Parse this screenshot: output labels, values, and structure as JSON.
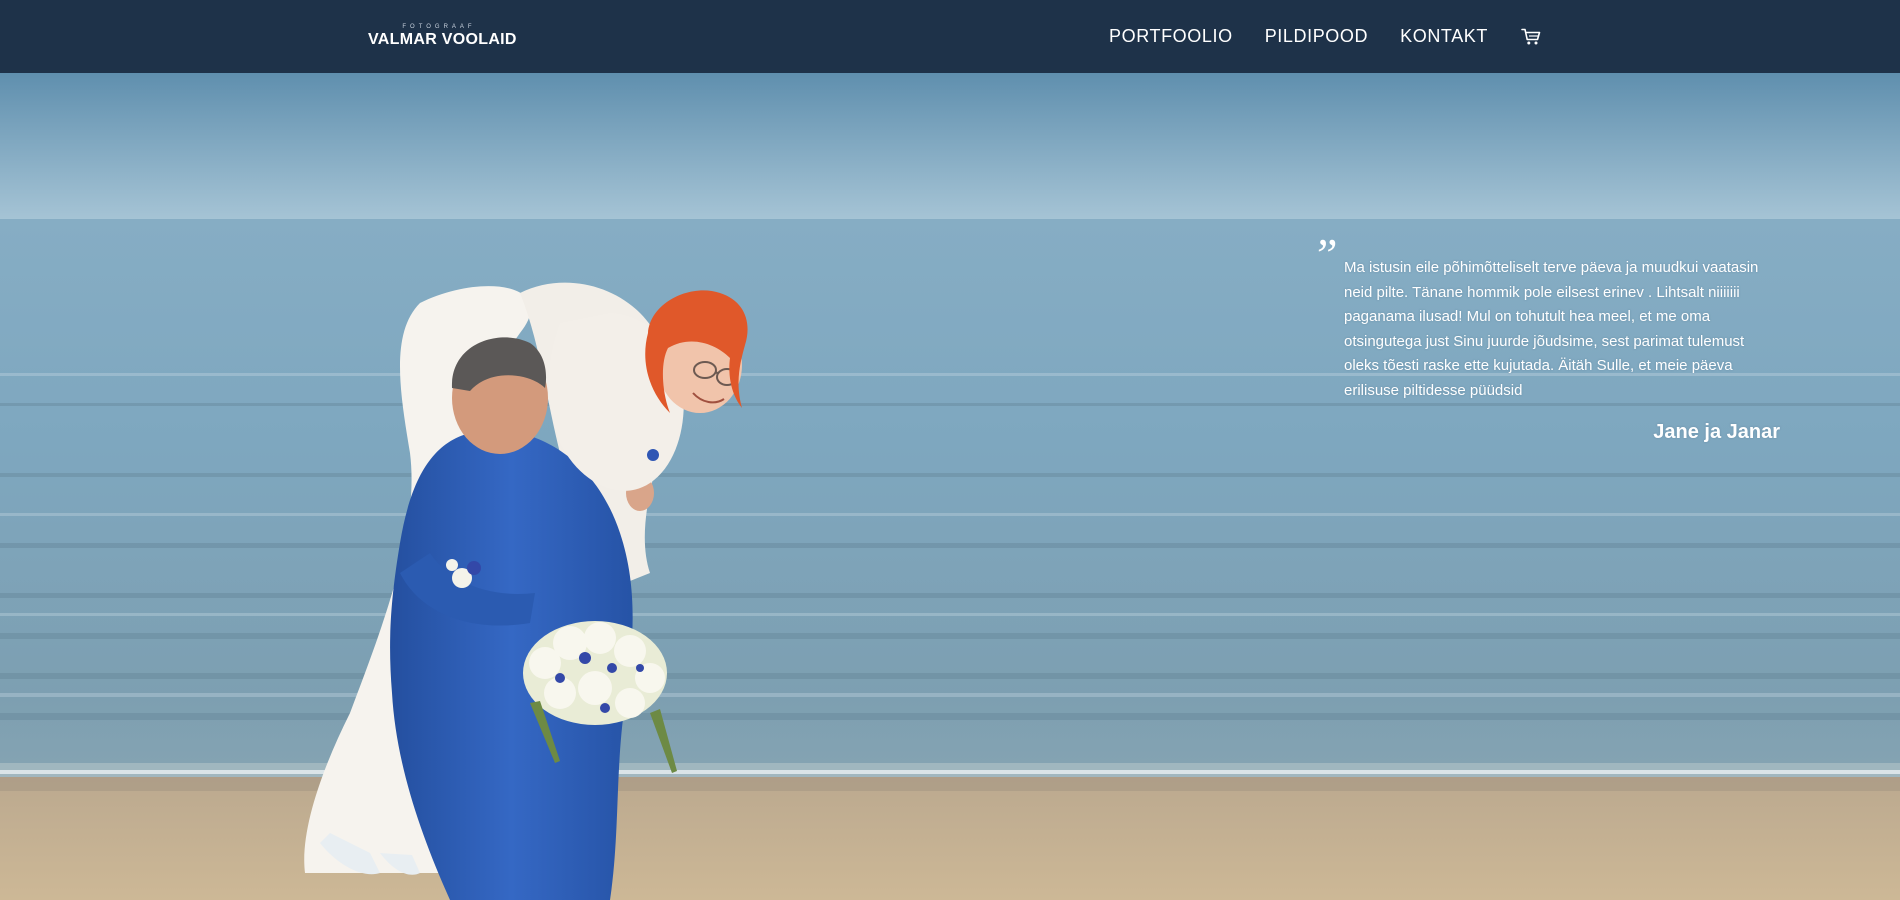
{
  "header": {
    "logo_small": "FOTOGRAAF",
    "logo_main": "VALMAR VOOLAID",
    "nav": [
      "PORTFOOLIO",
      "PILDIPOOD",
      "KONTAKT"
    ],
    "cart_icon": "shopping-cart-icon"
  },
  "testimonial": {
    "quote_mark": "”",
    "text": "Ma istusin eile põhimõtteliselt terve päeva ja muudkui vaatasin neid pilte. Tänane hommik pole eilsest erinev . Lihtsalt niiiiiii paganama ilusad! Mul on tohutult hea meel, et me oma otsingutega just Sinu juurde jõudsime, sest parimat tulemust oleks tõesti raske ette kujutada. Äitäh Sulle, et meie päeva erilisuse piltidesse püüdsid",
    "author": "Jane ja Janar"
  },
  "colors": {
    "header_bg": "#1e3249",
    "sky": "#8fb5cc",
    "sea": "#7fa8c0",
    "sand": "#c8b393",
    "suit": "#2f5fb8"
  }
}
